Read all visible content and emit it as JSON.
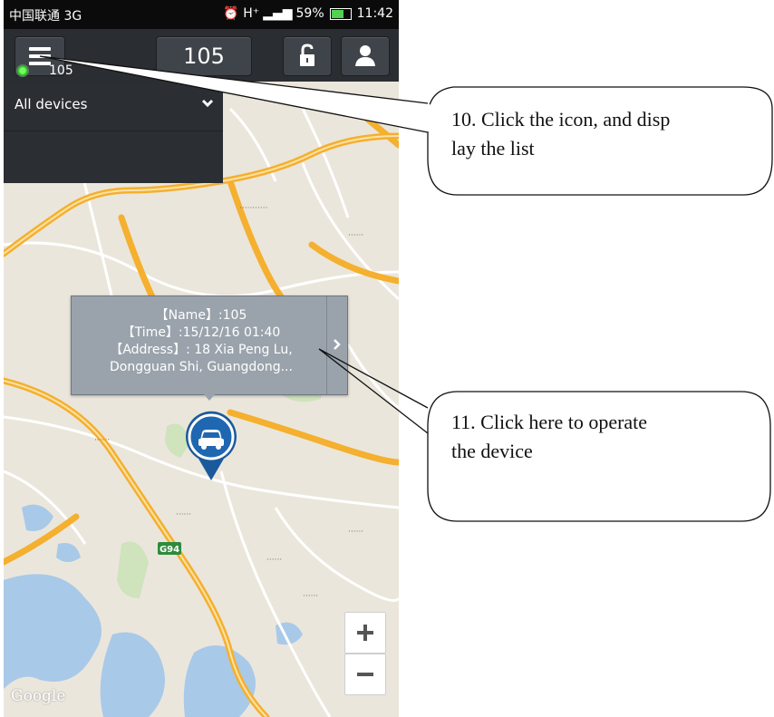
{
  "status_bar": {
    "carrier": "中国联通 3G",
    "indicators": "⏰ H⁺",
    "battery": "59%",
    "time": "11:42"
  },
  "toolbar": {
    "device_title": "105"
  },
  "device_list": {
    "header": "All devices",
    "items": [
      {
        "label": "105",
        "status_color": "#3fd13a"
      }
    ]
  },
  "info_popup": {
    "name_line": "【Name】:105",
    "time_line": "【Time】:15/12/16 01:40",
    "address_line1": "【Address】: 18 Xia Peng Lu,",
    "address_line2": "Dongguan Shi, Guangdong..."
  },
  "map": {
    "road_label": "G94",
    "zoom_in": "+",
    "zoom_out": "−",
    "attribution": "Google"
  },
  "callouts": {
    "c10_line1": "10. Click the icon, and disp",
    "c10_line2": "lay the list",
    "c11_line1": " 11. Click here to operate",
    "c11_line2": "the device"
  },
  "colors": {
    "toolbar_bg": "#2a2d31",
    "marker_blue": "#1a5a9c",
    "highway": "#f4b02e"
  }
}
